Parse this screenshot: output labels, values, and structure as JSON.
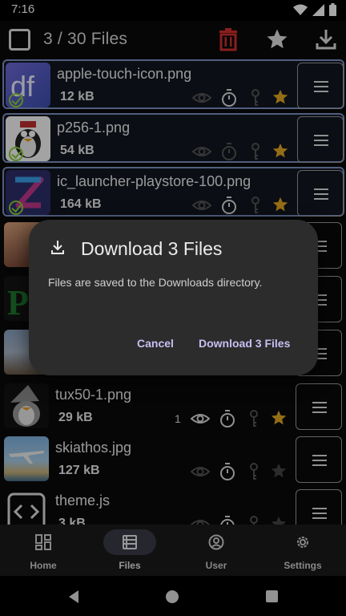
{
  "status_bar": {
    "time": "7:16"
  },
  "toolbar": {
    "title": "3 / 30 Files",
    "colors": {
      "delete": "#d32f2f",
      "icon": "#e0e0e0"
    }
  },
  "files": [
    {
      "name": "apple-touch-icon.png",
      "size": "12 kB",
      "selected": true,
      "starred": true,
      "views": ""
    },
    {
      "name": "p256-1.png",
      "size": "54 kB",
      "selected": true,
      "starred": true,
      "views": ""
    },
    {
      "name": "ic_launcher-playstore-100.png",
      "size": "164 kB",
      "selected": true,
      "starred": true,
      "views": ""
    },
    {
      "name": "tux50-1.png",
      "size": "29 kB",
      "selected": false,
      "starred": true,
      "views": "1"
    },
    {
      "name": "skiathos.jpg",
      "size": "127 kB",
      "selected": false,
      "starred": false,
      "views": ""
    },
    {
      "name": "theme.js",
      "size": "3 kB",
      "selected": false,
      "starred": false,
      "views": ""
    }
  ],
  "dialog": {
    "title": "Download 3 Files",
    "body": "Files are saved to the Downloads directory.",
    "cancel_label": "Cancel",
    "confirm_label": "Download 3 Files"
  },
  "bottom_nav": {
    "items": [
      {
        "label": "Home",
        "icon": "dashboard-icon",
        "active": false
      },
      {
        "label": "Files",
        "icon": "files-icon",
        "active": true
      },
      {
        "label": "User",
        "icon": "user-icon",
        "active": false
      },
      {
        "label": "Settings",
        "icon": "gear-icon",
        "active": false
      }
    ]
  },
  "colors": {
    "star": "#e5a823",
    "accent_text": "#c9bef2",
    "selected_border": "#7b93c4"
  }
}
